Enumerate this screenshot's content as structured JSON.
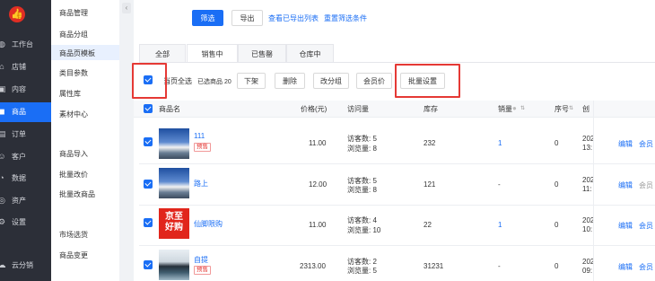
{
  "nav": {
    "logo_icon": "thumbs-up-logo-icon",
    "items": [
      {
        "icon": "dashboard-icon",
        "label": "工作台"
      },
      {
        "icon": "store-icon",
        "label": "店铺"
      },
      {
        "icon": "content-icon",
        "label": "内容"
      },
      {
        "icon": "goods-icon",
        "label": "商品"
      },
      {
        "icon": "order-icon",
        "label": "订单"
      },
      {
        "icon": "customer-icon",
        "label": "客户"
      },
      {
        "icon": "data-icon",
        "label": "数据"
      },
      {
        "icon": "asset-icon",
        "label": "资产"
      },
      {
        "icon": "settings-icon",
        "label": "设置"
      },
      {
        "icon": "cloud-icon",
        "label": "云分销"
      }
    ]
  },
  "submenu": {
    "items": [
      "商品管理",
      "商品分组",
      "商品页模板",
      "类目参数",
      "属性库",
      "素材中心",
      "商品导入",
      "批量改价",
      "批量改商品",
      "市场选货",
      "商品变更"
    ]
  },
  "toolbar": {
    "filter_label": "筛选",
    "export_label": "导出",
    "view_exports_label": "查看已导出列表",
    "reset_label": "重置筛选条件"
  },
  "tabs": [
    "全部",
    "销售中",
    "已售罄",
    "仓库中"
  ],
  "bulk": {
    "select_all_label": "当页全选",
    "selected_count_label": "已选商品 20",
    "actions": [
      "下架",
      "删除",
      "改分组",
      "会员价",
      "批量设置"
    ]
  },
  "table": {
    "headers": {
      "name": "商品名",
      "price": "价格(元)",
      "visits": "访问量",
      "stock": "库存",
      "sales": "销量",
      "order": "序号",
      "created": "创"
    },
    "rows": [
      {
        "name": "111",
        "tag": "预售",
        "price": "11.00",
        "visitors": "访客数: 5",
        "views": "浏览量: 8",
        "stock": "232",
        "sales": "1",
        "order": "0",
        "created": "202",
        "created2": "13:",
        "edit": "编辑",
        "member": "会员"
      },
      {
        "name": "路上",
        "tag": "",
        "price": "12.00",
        "visitors": "访客数: 5",
        "views": "浏览量: 8",
        "stock": "121",
        "sales": "-",
        "order": "0",
        "created": "202",
        "created2": "11:",
        "edit": "编辑",
        "member": "会员"
      },
      {
        "name": "仙脚限购",
        "tag": "",
        "price": "11.00",
        "visitors": "访客数: 4",
        "views": "浏览量: 10",
        "stock": "22",
        "sales": "1",
        "order": "0",
        "created": "202",
        "created2": "10:",
        "edit": "编辑",
        "member": "会员"
      },
      {
        "name": "自提",
        "tag": "预售",
        "price": "2313.00",
        "visitors": "访客数: 2",
        "views": "浏览量: 5",
        "stock": "31231",
        "sales": "-",
        "order": "0",
        "created": "202",
        "created2": "09:",
        "edit": "编辑",
        "member": "会员"
      }
    ],
    "jd_image_text_1": "京至",
    "jd_image_text_2": "好购"
  }
}
